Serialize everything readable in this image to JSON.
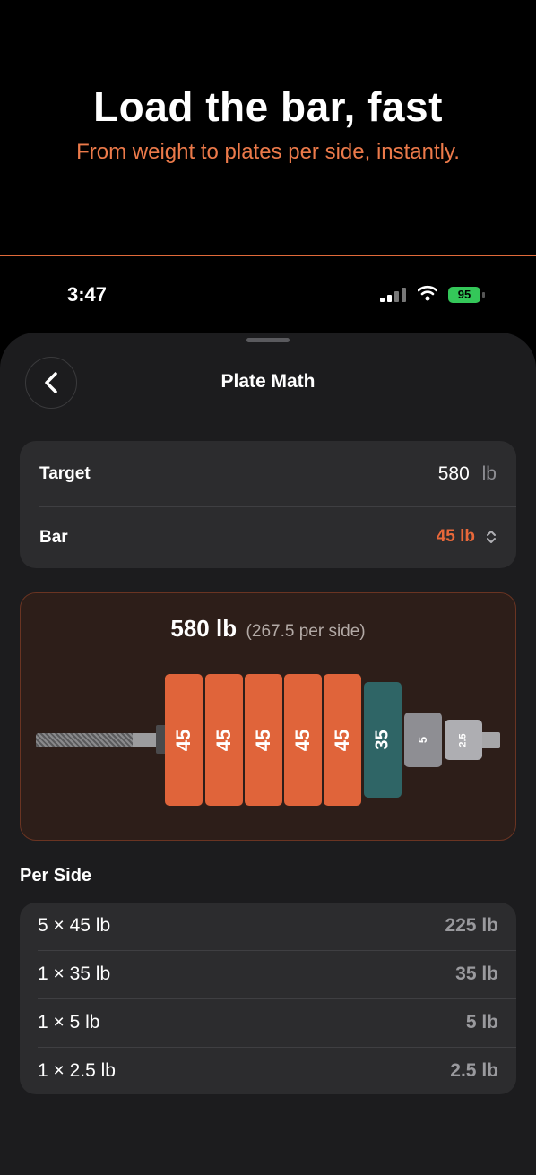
{
  "promo": {
    "headline": "Load the bar, fast",
    "subline": "From weight to plates per side, instantly."
  },
  "status_bar": {
    "time": "3:47",
    "battery": "95",
    "icons": [
      "signal-icon",
      "wifi-icon",
      "battery-icon"
    ]
  },
  "sheet": {
    "title": "Plate Math",
    "back_icon": "chevron-left-icon"
  },
  "inputs": {
    "target_label": "Target",
    "target_value": "580",
    "target_unit": "lb",
    "bar_label": "Bar",
    "bar_value": "45 lb",
    "bar_icon": "chevron-up-down-icon"
  },
  "visual": {
    "total": "580 lb",
    "per_side": "(267.5 per side)",
    "plates": [
      {
        "label": "45",
        "color": "#e0643a"
      },
      {
        "label": "45",
        "color": "#e0643a"
      },
      {
        "label": "45",
        "color": "#e0643a"
      },
      {
        "label": "45",
        "color": "#e0643a"
      },
      {
        "label": "45",
        "color": "#e0643a"
      },
      {
        "label": "35",
        "color": "#2f6566"
      },
      {
        "label": "5",
        "color": "#8e8e93"
      },
      {
        "label": "2.5",
        "color": "#aeaeb2"
      }
    ]
  },
  "per_side": {
    "title": "Per Side",
    "rows": [
      {
        "label": "5 × 45 lb",
        "value": "225 lb"
      },
      {
        "label": "1 × 35 lb",
        "value": "35 lb"
      },
      {
        "label": "1 × 5 lb",
        "value": "5 lb"
      },
      {
        "label": "1 × 2.5 lb",
        "value": "2.5 lb"
      }
    ]
  },
  "colors": {
    "accent": "#e8683a",
    "background": "#000000",
    "sheet": "#1c1c1e",
    "card": "#2c2c2e"
  }
}
